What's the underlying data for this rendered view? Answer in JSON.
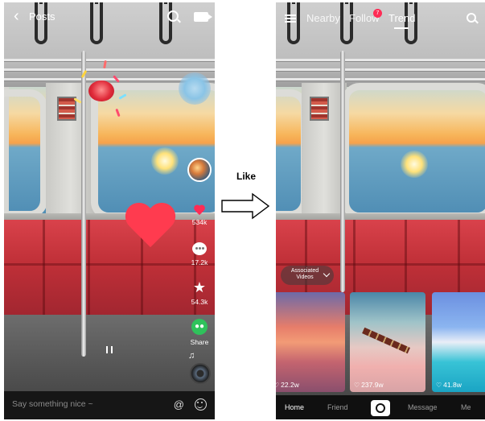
{
  "left": {
    "header": {
      "title": "Posts"
    },
    "actions": {
      "likes": "534k",
      "comments": "17.2k",
      "favorites": "54.3k",
      "share_label": "Share"
    },
    "comment_bar": {
      "placeholder": "Say something nice ~"
    }
  },
  "transition": {
    "label": "Like"
  },
  "right": {
    "header": {
      "tabs": [
        "Nearby",
        "Follow",
        "Trend"
      ],
      "active_tab": "Trend",
      "follow_badge": "7"
    },
    "associated": {
      "label": "Associated Videos"
    },
    "cards": [
      {
        "count": "22.2w"
      },
      {
        "count": "237.9w"
      },
      {
        "count": "41.8w"
      }
    ],
    "nav": {
      "items": [
        "Home",
        "Friend",
        "Message",
        "Me"
      ],
      "active": "Home"
    }
  },
  "colors": {
    "accent_red": "#fe2c55",
    "share_green": "#2fc25b",
    "seat_red": "#c03038"
  },
  "icons": [
    "back-icon",
    "search-icon",
    "camera-icon",
    "heart-icon",
    "comment-icon",
    "star-icon",
    "share-icon",
    "music-note-icon",
    "pause-icon",
    "at-icon",
    "emoji-icon",
    "hamburger-icon",
    "chevron-down-icon",
    "create-icon"
  ]
}
